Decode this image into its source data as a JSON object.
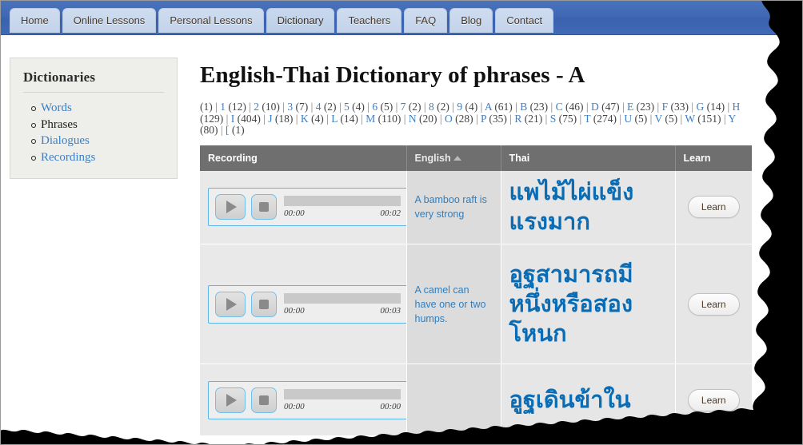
{
  "nav": {
    "tabs": [
      {
        "label": "Home",
        "active": false
      },
      {
        "label": "Online Lessons",
        "active": false
      },
      {
        "label": "Personal Lessons",
        "active": false
      },
      {
        "label": "Dictionary",
        "active": true
      },
      {
        "label": "Teachers",
        "active": false
      },
      {
        "label": "FAQ",
        "active": false
      },
      {
        "label": "Blog",
        "active": false
      },
      {
        "label": "Contact",
        "active": false
      }
    ]
  },
  "sidebar": {
    "title": "Dictionaries",
    "items": [
      {
        "label": "Words",
        "current": false
      },
      {
        "label": "Phrases",
        "current": true
      },
      {
        "label": "Dialogues",
        "current": false
      },
      {
        "label": "Recordings",
        "current": false
      }
    ]
  },
  "main": {
    "title": "English-Thai Dictionary of phrases - A",
    "separator": "|",
    "alphabet_index": [
      {
        "letter": "",
        "count": "(1)"
      },
      {
        "letter": "1",
        "count": "(12)"
      },
      {
        "letter": "2",
        "count": "(10)"
      },
      {
        "letter": "3",
        "count": "(7)"
      },
      {
        "letter": "4",
        "count": "(2)"
      },
      {
        "letter": "5",
        "count": "(4)"
      },
      {
        "letter": "6",
        "count": "(5)"
      },
      {
        "letter": "7",
        "count": "(2)"
      },
      {
        "letter": "8",
        "count": "(2)"
      },
      {
        "letter": "9",
        "count": "(4)"
      },
      {
        "letter": "A",
        "count": "(61)"
      },
      {
        "letter": "B",
        "count": "(23)"
      },
      {
        "letter": "C",
        "count": "(46)"
      },
      {
        "letter": "D",
        "count": "(47)"
      },
      {
        "letter": "E",
        "count": "(23)"
      },
      {
        "letter": "F",
        "count": "(33)"
      },
      {
        "letter": "G",
        "count": "(14)"
      },
      {
        "letter": "H",
        "count": "(129)"
      },
      {
        "letter": "I",
        "count": "(404)"
      },
      {
        "letter": "J",
        "count": "(18)"
      },
      {
        "letter": "K",
        "count": "(4)"
      },
      {
        "letter": "L",
        "count": "(14)"
      },
      {
        "letter": "M",
        "count": "(110)"
      },
      {
        "letter": "N",
        "count": "(20)"
      },
      {
        "letter": "O",
        "count": "(28)"
      },
      {
        "letter": "P",
        "count": "(35)"
      },
      {
        "letter": "R",
        "count": "(21)"
      },
      {
        "letter": "S",
        "count": "(75)"
      },
      {
        "letter": "T",
        "count": "(274)"
      },
      {
        "letter": "U",
        "count": "(5)"
      },
      {
        "letter": "V",
        "count": "(5)"
      },
      {
        "letter": "W",
        "count": "(151)"
      },
      {
        "letter": "Y",
        "count": "(80)"
      },
      {
        "letter": "[",
        "count": "(1)"
      }
    ]
  },
  "table": {
    "headers": {
      "recording": "Recording",
      "english": "English",
      "thai": "Thai",
      "learn": "Learn"
    },
    "sorted_column": "English",
    "sort_direction": "asc",
    "learn_label": "Learn",
    "rows": [
      {
        "english": "A bamboo raft is very strong",
        "thai": "แพไม้ไผ่แข็งแรงมาก",
        "time_current": "00:00",
        "time_total": "00:02"
      },
      {
        "english": "A camel can have one or two humps.",
        "thai": "อูฐสามารถมีหนึ่งหรือสองโหนก",
        "time_current": "00:00",
        "time_total": "00:03"
      },
      {
        "english": "",
        "thai": "อูฐเดินข้าใน",
        "time_current": "00:00",
        "time_total": "00:00"
      }
    ]
  },
  "colors": {
    "navbar_blue": "#4068b4",
    "link_blue": "#3c7fc4",
    "thai_blue": "#0a6cb4",
    "header_gray": "#6f6f6f",
    "player_border": "#5bb6e8"
  }
}
